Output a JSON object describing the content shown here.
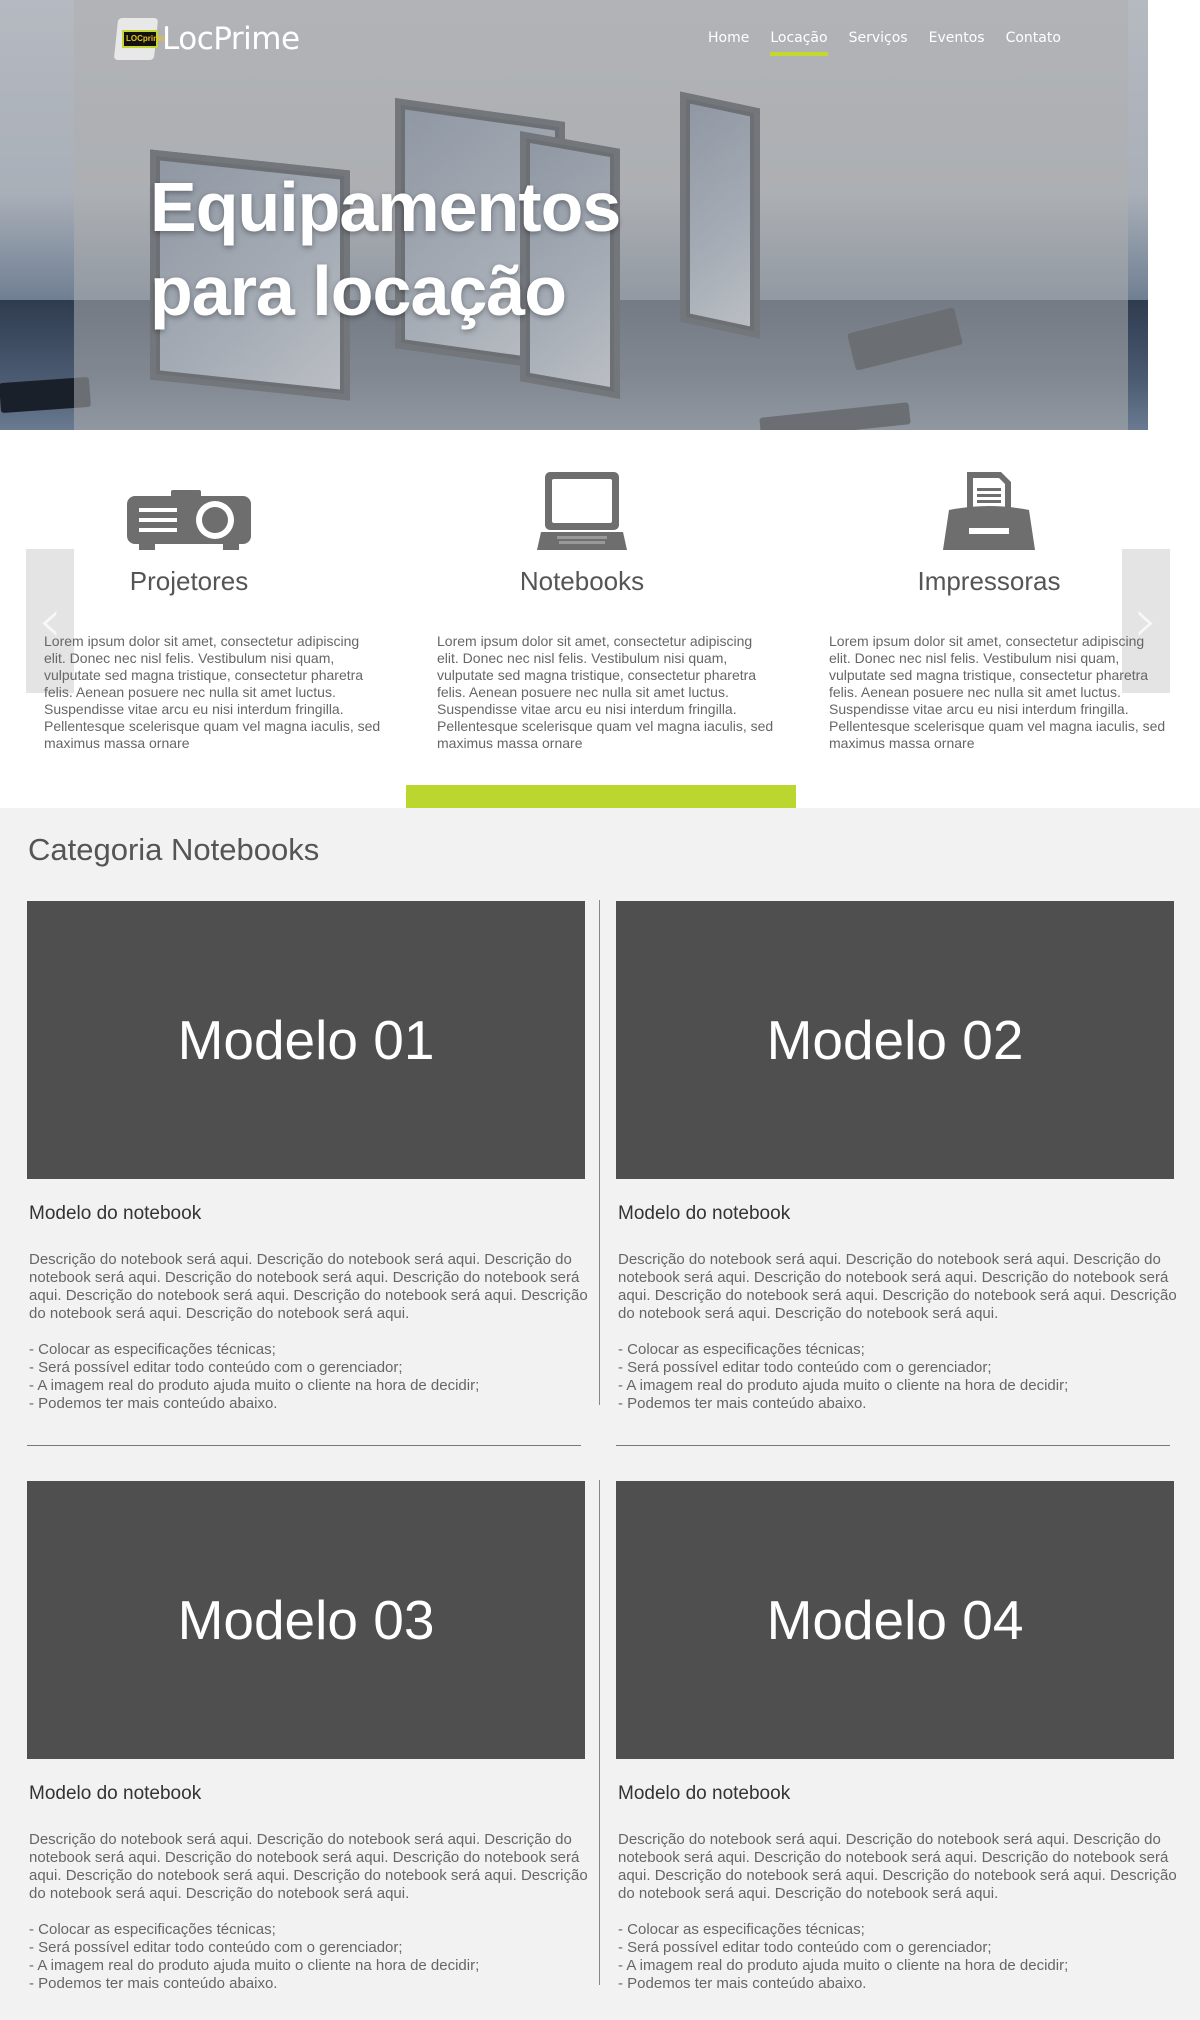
{
  "brand": {
    "name": "LocPrime",
    "logo_badge": "LOCprime"
  },
  "nav": {
    "items": [
      {
        "label": "Home",
        "active": false
      },
      {
        "label": "Locação",
        "active": true
      },
      {
        "label": "Serviços",
        "active": false
      },
      {
        "label": "Eventos",
        "active": false
      },
      {
        "label": "Contato",
        "active": false
      }
    ]
  },
  "hero": {
    "title_line1": "Equipamentos",
    "title_line2": "para locação"
  },
  "carousel": {
    "prev_icon": "chevron-left-icon",
    "next_icon": "chevron-right-icon",
    "items": [
      {
        "icon": "projector-icon",
        "title": "Projetores",
        "text": "Lorem ipsum dolor sit amet, consectetur adipiscing elit. Donec nec nisl felis. Vestibulum nisi quam, vulputate sed magna tristique, consectetur pharetra felis. Aenean posuere nec nulla sit amet luctus. Suspendisse vitae arcu eu nisi interdum fringilla. Pellentesque scelerisque quam vel magna iaculis, sed maximus massa ornare"
      },
      {
        "icon": "laptop-icon",
        "title": "Notebooks",
        "text": "Lorem ipsum dolor sit amet, consectetur adipiscing elit. Donec nec nisl felis. Vestibulum nisi quam, vulputate sed magna tristique, consectetur pharetra felis. Aenean posuere nec nulla sit amet luctus. Suspendisse vitae arcu eu nisi interdum fringilla. Pellentesque scelerisque quam vel magna iaculis, sed maximus massa ornare"
      },
      {
        "icon": "printer-icon",
        "title": "Impressoras",
        "text": "Lorem ipsum dolor sit amet, consectetur adipiscing elit. Donec nec nisl felis. Vestibulum nisi quam, vulputate sed magna tristique, consectetur pharetra felis. Aenean posuere nec nulla sit amet luctus. Suspendisse vitae arcu eu nisi interdum fringilla. Pellentesque scelerisque quam vel magna iaculis, sed maximus massa ornare"
      }
    ]
  },
  "category": {
    "title": "Categoria Notebooks",
    "products": [
      {
        "thumb_label": "Modelo 01",
        "name": "Modelo do notebook",
        "description": "Descrição do notebook será aqui. Descrição do notebook será aqui. Descrição do notebook será aqui. Descrição do notebook será aqui. Descrição do notebook será aqui. Descrição do notebook será aqui. Descrição do notebook será aqui. Descrição do notebook será aqui. Descrição do notebook será aqui.",
        "specs": [
          "- Colocar as especificações técnicas;",
          "- Será possível editar todo conteúdo com o gerenciador;",
          "- A imagem real do produto ajuda muito o cliente na hora de decidir;",
          "- Podemos ter mais conteúdo abaixo."
        ]
      },
      {
        "thumb_label": "Modelo 02",
        "name": "Modelo do notebook",
        "description": "Descrição do notebook será aqui. Descrição do notebook será aqui. Descrição do notebook será aqui. Descrição do notebook será aqui. Descrição do notebook será aqui. Descrição do notebook será aqui. Descrição do notebook será aqui. Descrição do notebook será aqui. Descrição do notebook será aqui.",
        "specs": [
          "- Colocar as especificações técnicas;",
          "- Será possível editar todo conteúdo com o gerenciador;",
          "- A imagem real do produto ajuda muito o cliente na hora de decidir;",
          "- Podemos ter mais conteúdo abaixo."
        ]
      },
      {
        "thumb_label": "Modelo 03",
        "name": "Modelo do notebook",
        "description": "Descrição do notebook será aqui. Descrição do notebook será aqui. Descrição do notebook será aqui. Descrição do notebook será aqui. Descrição do notebook será aqui. Descrição do notebook será aqui. Descrição do notebook será aqui. Descrição do notebook será aqui. Descrição do notebook será aqui.",
        "specs": [
          "- Colocar as especificações técnicas;",
          "- Será possível editar todo conteúdo com o gerenciador;",
          "- A imagem real do produto ajuda muito o cliente na hora de decidir;",
          "- Podemos ter mais conteúdo abaixo."
        ]
      },
      {
        "thumb_label": "Modelo 04",
        "name": "Modelo do notebook",
        "description": "Descrição do notebook será aqui. Descrição do notebook será aqui. Descrição do notebook será aqui. Descrição do notebook será aqui. Descrição do notebook será aqui. Descrição do notebook será aqui. Descrição do notebook será aqui. Descrição do notebook será aqui. Descrição do notebook será aqui.",
        "specs": [
          "- Colocar as especificações técnicas;",
          "- Será possível editar todo conteúdo com o gerenciador;",
          "- A imagem real do produto ajuda muito o cliente na hora de decidir;",
          "- Podemos ter mais conteúdo abaixo."
        ]
      }
    ]
  },
  "colors": {
    "accent": "#bcd630",
    "thumb_bg": "#4f4f4f",
    "page_bg": "#f2f2f2"
  }
}
